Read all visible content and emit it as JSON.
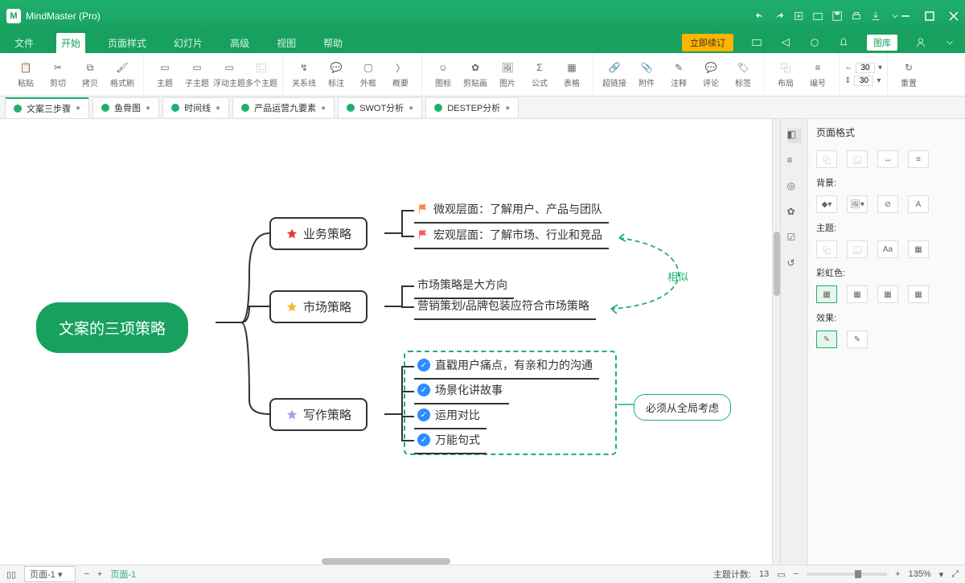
{
  "app": {
    "title": "MindMaster (Pro)"
  },
  "menu": [
    "文件",
    "开始",
    "页面样式",
    "幻灯片",
    "高级",
    "视图",
    "帮助"
  ],
  "menu_active": 1,
  "promo": "立即续订",
  "rbtn_label": "图库",
  "ribbon": [
    [
      "粘贴",
      "剪切",
      "拷贝",
      "格式刷"
    ],
    [
      "主题",
      "子主题",
      "浮动主题",
      "多个主题"
    ],
    [
      "关系线",
      "标注",
      "外框",
      "概要"
    ],
    [
      "图标",
      "剪贴画",
      "图片",
      "公式",
      "表格"
    ],
    [
      "超链接",
      "附件",
      "注释",
      "评论",
      "标签"
    ],
    [
      "布局",
      "编号"
    ]
  ],
  "ribbon_nums": {
    "a": "30",
    "b": "30",
    "refresh": "重置"
  },
  "doc_tabs": [
    {
      "label": "文案三步骤",
      "active": true
    },
    {
      "label": "鱼骨图"
    },
    {
      "label": "时间线"
    },
    {
      "label": "产品运营九要素"
    },
    {
      "label": "SWOT分析"
    },
    {
      "label": "DESTEP分析"
    }
  ],
  "side": {
    "title": "页面格式",
    "bg": "背景:",
    "theme": "主题:",
    "rainbow": "彩虹色:",
    "effect": "效果:"
  },
  "map": {
    "root": "文案的三项策略",
    "b1": "业务策略",
    "b1_leaves": [
      "微观层面：了解用户、产品与团队",
      "宏观层面：了解市场、行业和竞品"
    ],
    "b2": "市场策略",
    "b2_leaves": [
      "市场策略是大方向",
      "营销策划/品牌包装应符合市场策略"
    ],
    "b3": "写作策略",
    "b3_leaves": [
      "直戳用户痛点，有亲和力的沟通",
      "场景化讲故事",
      "运用对比",
      "万能句式"
    ],
    "annot": "相似",
    "callout": "必须从全局考虑"
  },
  "status": {
    "page_sel": "页面-1",
    "page_name": "页面-1",
    "topic_count_label": "主题计数:",
    "topic_count": "13",
    "zoom": "135%"
  }
}
